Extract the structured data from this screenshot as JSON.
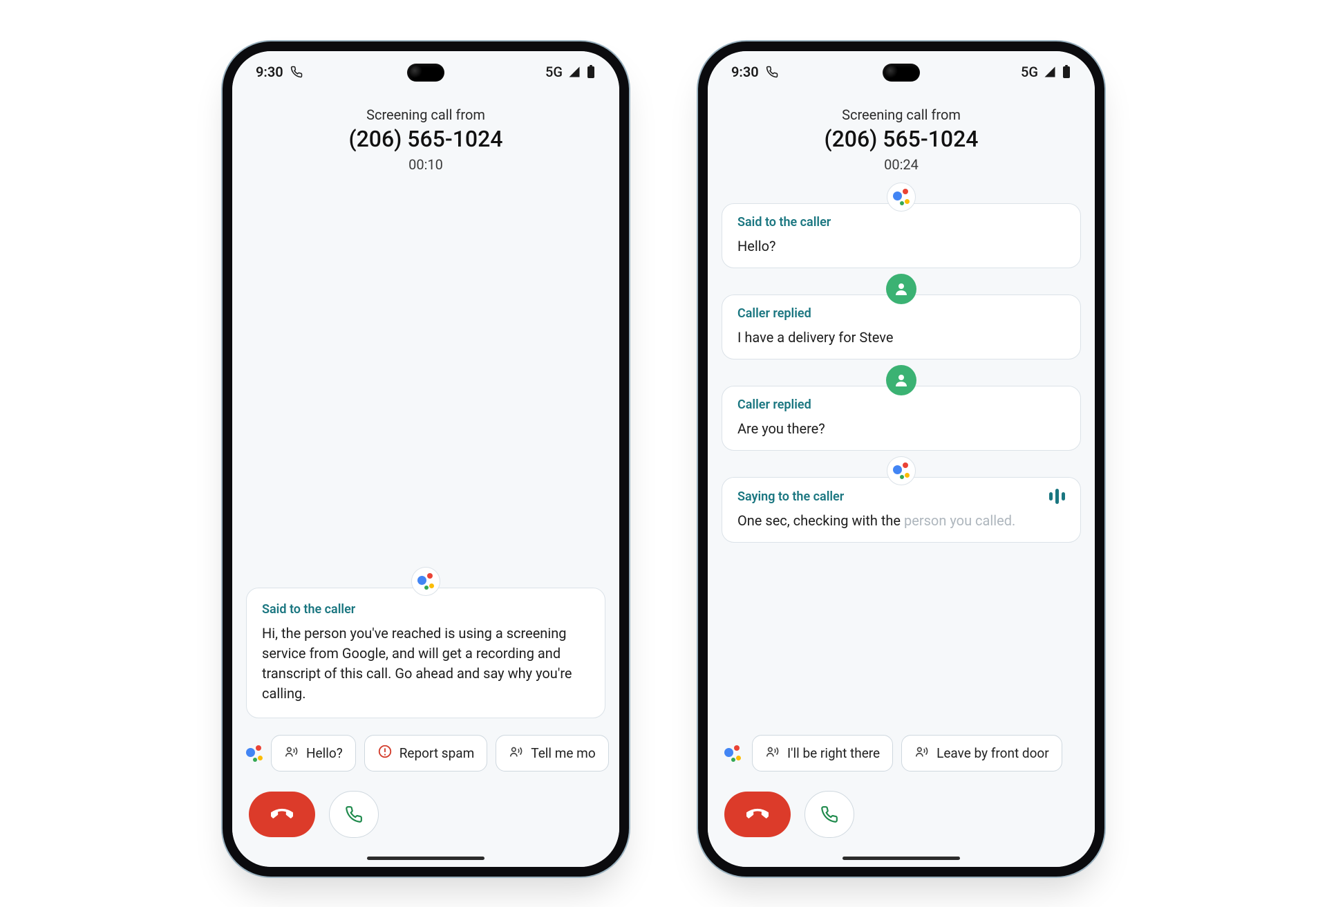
{
  "phoneA": {
    "status": {
      "time": "9:30",
      "network": "5G"
    },
    "header": {
      "subtitle": "Screening call from",
      "number": "(206) 565-1024",
      "timer": "00:10"
    },
    "transcript": [
      {
        "speaker": "assistant",
        "tag": "Said to the caller",
        "body": "Hi, the person you've reached is using a screening service from Google, and will get a recording and transcript of this call. Go ahead and say why you're calling."
      }
    ],
    "chips": [
      {
        "icon": "voice",
        "label": "Hello?"
      },
      {
        "icon": "alert",
        "label": "Report spam"
      },
      {
        "icon": "voice",
        "label": "Tell me mo"
      }
    ]
  },
  "phoneB": {
    "status": {
      "time": "9:30",
      "network": "5G"
    },
    "header": {
      "subtitle": "Screening call from",
      "number": "(206) 565-1024",
      "timer": "00:24"
    },
    "transcript": [
      {
        "speaker": "assistant",
        "tag": "Said to the caller",
        "body": "Hello?"
      },
      {
        "speaker": "caller",
        "tag": "Caller replied",
        "body": "I have a delivery for Steve"
      },
      {
        "speaker": "caller",
        "tag": "Caller replied",
        "body": "Are you there?"
      },
      {
        "speaker": "assistant_live",
        "tag": "Saying to the caller",
        "body_plain": "One sec, checking with the ",
        "body_fade": "person you called."
      }
    ],
    "chips": [
      {
        "icon": "voice",
        "label": "I'll be right there"
      },
      {
        "icon": "voice",
        "label": "Leave by front door"
      }
    ]
  }
}
